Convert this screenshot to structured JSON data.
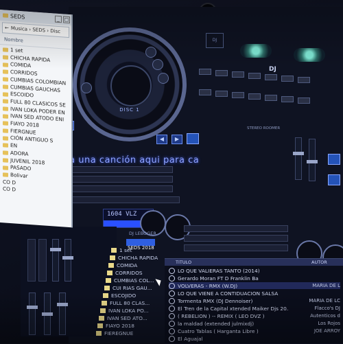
{
  "explorer": {
    "title": "SEDS",
    "address": "Musica › SEDS › Disc",
    "column_header": "Nombre",
    "items": [
      {
        "label": "1 set"
      },
      {
        "label": "CHICHA RAPIDA"
      },
      {
        "label": "COMIDA"
      },
      {
        "label": "CORRIDOS"
      },
      {
        "label": "CUMBIAS COLOMBIAN"
      },
      {
        "label": "CUMBIAS GAUCHAS"
      },
      {
        "label": "ESCOIDO"
      },
      {
        "label": "FULL 80 CLASICOS SE"
      },
      {
        "label": "IVAN LOKA PODER EN"
      },
      {
        "label": "IVAN SED ATODO ENI"
      },
      {
        "label": "FIAYO 2018"
      },
      {
        "label": "FIERGNUE"
      },
      {
        "label": "CIÓN ANTIGUO S"
      },
      {
        "label": "EN"
      },
      {
        "label": "ADORA"
      },
      {
        "label": "JUVENIL 2018"
      },
      {
        "label": "PASADO"
      },
      {
        "label": "Bolivar"
      },
      {
        "label": ""
      },
      {
        "label": "CO D"
      },
      {
        "label": ""
      },
      {
        "label": "CO D"
      }
    ]
  },
  "app": {
    "disc_label": "DISC 1",
    "logo_label": "DJ",
    "dj_label": "DJ",
    "drop_hint": "Mueva una canción aqui para ca",
    "bpm_display": "1604 VLZ",
    "mixer_label": "STEREO ROOMER",
    "colors": {
      "accent": "#2f5fe0",
      "text": "#8ea3ff",
      "led": "#7fe7d4"
    }
  },
  "tree": {
    "header": "DJ LEBOGER",
    "selected": "SEDS 2018",
    "items": [
      {
        "label": "1 set"
      },
      {
        "label": "CHICHA RAPIDA"
      },
      {
        "label": "COMIDA"
      },
      {
        "label": "CORRIDOS"
      },
      {
        "label": "CUMBIAS COL..."
      },
      {
        "label": "CUI RIAS GAU..."
      },
      {
        "label": "ESCOJIDO"
      },
      {
        "label": "FULL 80 CLAS..."
      },
      {
        "label": "IVAN LOKA PO..."
      },
      {
        "label": "IVAN SED ATO..."
      },
      {
        "label": "FIAYO 2018"
      },
      {
        "label": "FIEREGNUE"
      }
    ]
  },
  "playlist": {
    "col_title": "TITULO",
    "col_artist": "AUTOR",
    "rows": [
      {
        "title": "LO QUE VALIERAS TANTO (2014)",
        "artist": ""
      },
      {
        "title": "Gerardo Moran FT D Franklin Ba",
        "artist": ""
      },
      {
        "title": "VOLVERAS - RMX (W.DJ)",
        "artist": "MARIA DE L"
      },
      {
        "title": "LO QUE VIENE A CONTIDUACION SALSA",
        "artist": ""
      },
      {
        "title": "Tormenta RMX (DJ Dennoiser)",
        "artist": "MARIA DE LC"
      },
      {
        "title": "El Tren de la Capital xtended Maiker Djs 20..",
        "artist": "Flacco's DJ"
      },
      {
        "title": "( REBELION ) -- REMIX ( LEO DVZ )",
        "artist": "Autenticos d"
      },
      {
        "title": "la maldad (extended julmixdj)",
        "artist": "Los Rojos"
      },
      {
        "title": "Cuatro Tablas ( Harganta Libre )",
        "artist": "JOE ARROY"
      },
      {
        "title": "El Aguajal",
        "artist": ""
      }
    ]
  }
}
